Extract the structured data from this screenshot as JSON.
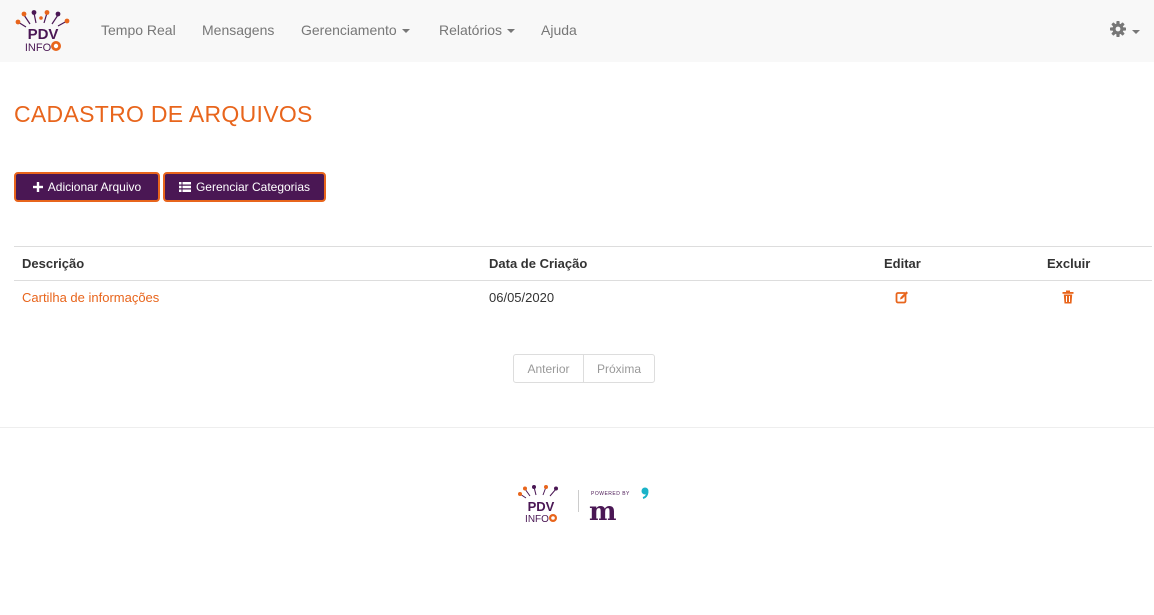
{
  "brand": {
    "logo_line1": "PDV",
    "logo_line2": "INFO",
    "powered_by": "POWERED BY",
    "powered_mark": "m"
  },
  "nav": {
    "items": [
      {
        "label": "Tempo Real"
      },
      {
        "label": "Mensagens"
      },
      {
        "label": "Gerenciamento"
      },
      {
        "label": "Relatórios"
      },
      {
        "label": "Ajuda"
      }
    ]
  },
  "page": {
    "title": "CADASTRO DE ARQUIVOS"
  },
  "actions": {
    "add_label": "Adicionar Arquivo",
    "categories_label": "Gerenciar Categorias"
  },
  "table": {
    "headers": {
      "description": "Descrição",
      "created": "Data de Criação",
      "edit": "Editar",
      "delete": "Excluir"
    },
    "rows": [
      {
        "description": "Cartilha de informações",
        "created": "06/05/2020"
      }
    ]
  },
  "pagination": {
    "previous": "Anterior",
    "next": "Próxima"
  },
  "colors": {
    "accent": "#e8651c",
    "brand_purple": "#4a1754",
    "navbar_bg": "#f8f8f8"
  },
  "icons": {
    "add": "plus-icon",
    "categories": "list-icon",
    "edit": "edit-icon",
    "delete": "trash-icon",
    "settings": "gear-icon"
  }
}
